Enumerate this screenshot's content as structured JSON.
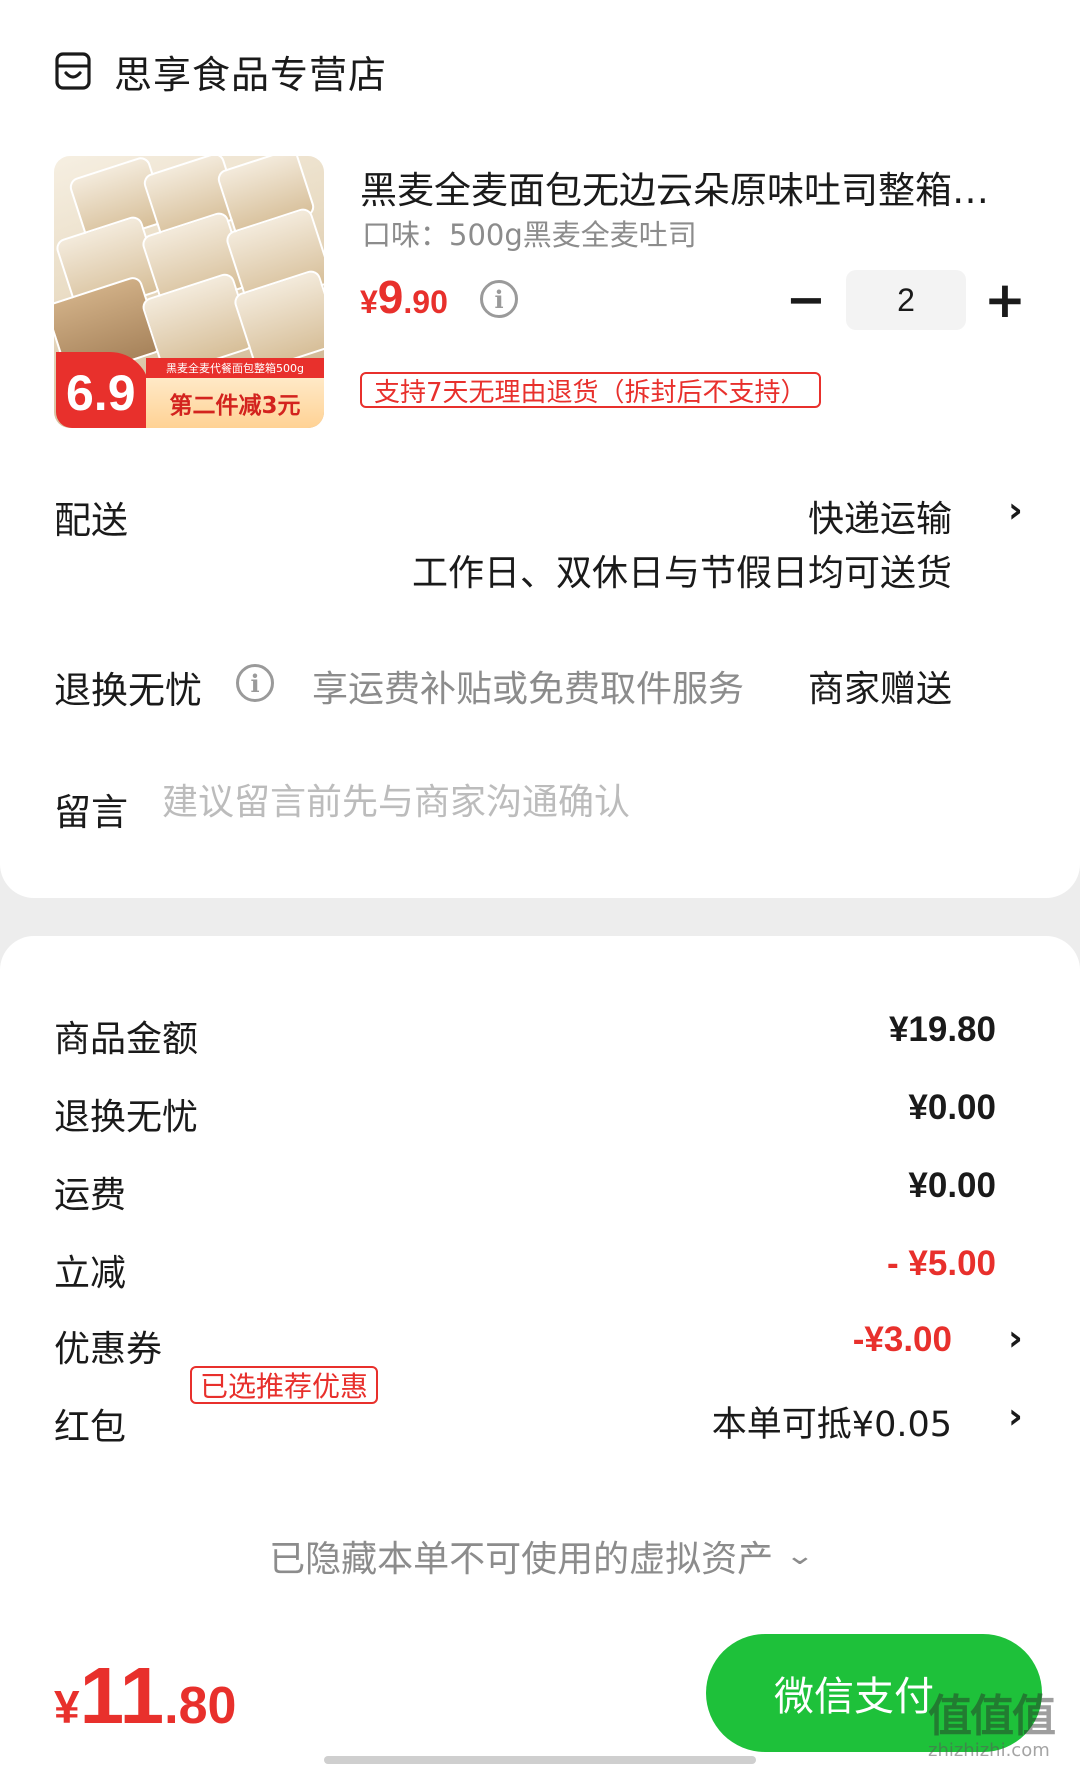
{
  "store": {
    "name": "思享食品专营店",
    "icon": "store-icon"
  },
  "product": {
    "title": "黑麦全麦面包无边云朵原味吐司整箱…",
    "spec": "口味：500g黑麦全麦吐司",
    "price": {
      "currency": "¥",
      "integer": "9",
      "decimal": ".90"
    },
    "quantity": "2",
    "minus_label": "−",
    "plus_label": "+",
    "return_policy": "支持7天无理由退货（拆封后不支持）",
    "image": {
      "sticker_price": "6.9",
      "banner_text": "第二件减3元",
      "strip_text": "黑麦全麦代餐面包整箱500g"
    }
  },
  "delivery": {
    "label": "配送",
    "method": "快递运输",
    "schedule": "工作日、双休日与节假日均可送货"
  },
  "return_worry_free": {
    "label": "退换无忧",
    "description": "享运费补贴或免费取件服务",
    "provider": "商家赠送"
  },
  "note": {
    "label": "留言",
    "placeholder": "建议留言前先与商家沟通确认"
  },
  "summary": {
    "rows": [
      {
        "label": "商品金额",
        "value": "¥19.80"
      },
      {
        "label": "退换无忧",
        "value": "¥0.00"
      },
      {
        "label": "运费",
        "value": "¥0.00"
      },
      {
        "label": "立减",
        "value": "- ¥5.00"
      },
      {
        "label": "优惠券",
        "tag": "已选推荐优惠",
        "value": "-¥3.00"
      },
      {
        "label": "红包",
        "value": "本单可抵¥0.05"
      }
    ],
    "hidden_assets": "已隐藏本单不可使用的虚拟资产"
  },
  "footer": {
    "total": {
      "currency": "¥",
      "integer": "11",
      "decimal": ".80"
    },
    "pay_button": "微信支付"
  },
  "watermark": {
    "main": "值值值",
    "sub": "zhizhizhi.com"
  },
  "colors": {
    "accent_red": "#e8302c",
    "pay_green": "#1ec13a",
    "muted": "#8c8c8c"
  }
}
